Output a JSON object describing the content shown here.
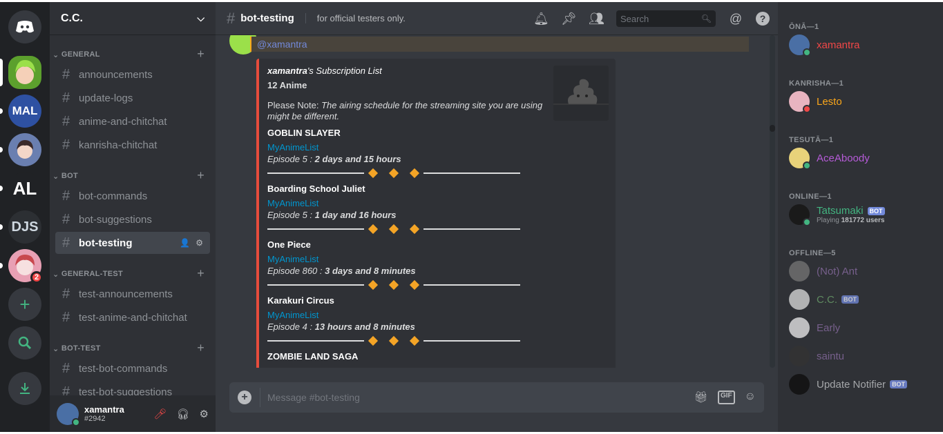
{
  "server": {
    "name": "C.C.",
    "rail_servers": [
      {
        "name": "server-cc",
        "label": "",
        "color": "#5ca02d"
      },
      {
        "name": "server-mal",
        "label": "MAL",
        "color": "#2e51a2"
      },
      {
        "name": "server-anime-girl",
        "label": "",
        "color": "#6a7fb0"
      },
      {
        "name": "server-anilist",
        "label": "AL",
        "color": "#202225"
      },
      {
        "name": "server-djs",
        "label": "DJS",
        "color": "#2c2f33"
      },
      {
        "name": "server-pink",
        "label": "",
        "color": "#e8a0b4",
        "badge": "2"
      }
    ]
  },
  "categories": [
    {
      "name": "GENERAL",
      "channels": [
        "announcements",
        "update-logs",
        "anime-and-chitchat",
        "kanrisha-chitchat"
      ]
    },
    {
      "name": "BOT",
      "channels": [
        "bot-commands",
        "bot-suggestions",
        "bot-testing"
      ]
    },
    {
      "name": "GENERAL-TEST",
      "channels": [
        "test-announcements",
        "test-anime-and-chitchat"
      ]
    },
    {
      "name": "BOT-TEST",
      "channels": [
        "test-bot-commands",
        "test-bot-suggestions"
      ]
    }
  ],
  "user": {
    "name": "xamantra",
    "tag": "#2942"
  },
  "channel": {
    "name": "bot-testing",
    "topic": "for official testers only."
  },
  "search": {
    "placeholder": "Search"
  },
  "message": {
    "mention": "@xamantra",
    "embed": {
      "title_user": "xamantra",
      "title_rest": "'s Subscription List",
      "subtitle": "12 Anime",
      "note_label": "Please Note:",
      "note_text": "The airing schedule for the streaming site you are using might be different.",
      "anime": [
        {
          "title": "GOBLIN SLAYER",
          "link": "MyAnimeList",
          "episode": "Episode 5 :",
          "time": "2 days and 15 hours"
        },
        {
          "title": "Boarding School Juliet",
          "link": "MyAnimeList",
          "episode": "Episode 5 :",
          "time": "1 day and 16 hours"
        },
        {
          "title": "One Piece",
          "link": "MyAnimeList",
          "episode": "Episode 860 :",
          "time": "3 days and 8 minutes"
        },
        {
          "title": "Karakuri Circus",
          "link": "MyAnimeList",
          "episode": "Episode 4 :",
          "time": "13 hours and 8 minutes"
        },
        {
          "title": "ZOMBIE LAND SAGA",
          "link": "",
          "episode": "",
          "time": ""
        }
      ]
    }
  },
  "composer": {
    "placeholder": "Message #bot-testing",
    "gif": "GIF"
  },
  "members": [
    {
      "group": "ŌNĀ—1",
      "list": [
        {
          "name": "xamantra",
          "color": "#f04747",
          "status": "#43b581",
          "avatar": "#4a6fa5"
        }
      ]
    },
    {
      "group": "KANRISHA—1",
      "list": [
        {
          "name": "Lesto",
          "color": "#faa61a",
          "status": "#f04747",
          "avatar": "#e8b4c0"
        }
      ]
    },
    {
      "group": "TESUTĀ—1",
      "list": [
        {
          "name": "AceAboody",
          "color": "#b65bd8",
          "status": "#43b581",
          "avatar": "#e8d27a"
        }
      ]
    },
    {
      "group": "ONLINE—1",
      "list": [
        {
          "name": "Tatsumaki",
          "color": "#43b581",
          "status": "#43b581",
          "avatar": "#1a1a1a",
          "bot": "BOT",
          "sub_prefix": "Playing",
          "sub_bold": "181772 users"
        }
      ]
    },
    {
      "group": "OFFLINE—5",
      "list": [
        {
          "name": "(Not) Ant",
          "color": "#8e6fa8",
          "avatar": "#777"
        },
        {
          "name": "C.C.",
          "color": "#6fa86f",
          "avatar": "#ddd",
          "bot": "BOT"
        },
        {
          "name": "Early",
          "color": "#8e6fa8",
          "avatar": "#eee"
        },
        {
          "name": "saintu",
          "color": "#8e6fa8",
          "avatar": "#333"
        },
        {
          "name": "Update Notifier",
          "color": "#b9bbbe",
          "avatar": "#111",
          "bot": "BOT"
        }
      ]
    }
  ]
}
